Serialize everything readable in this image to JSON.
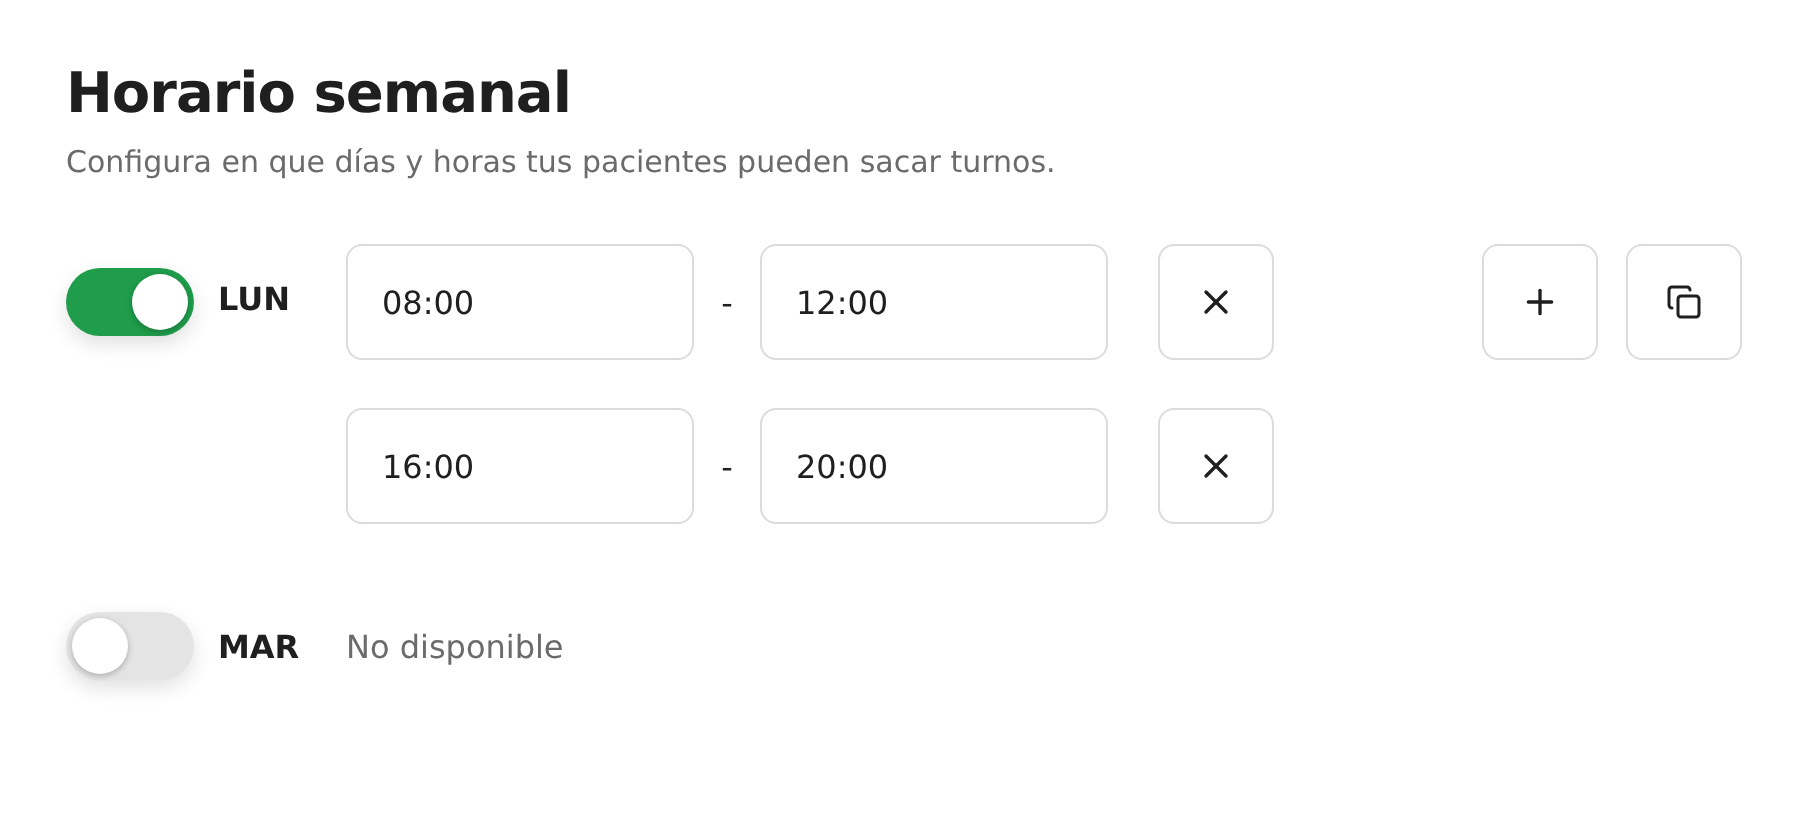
{
  "title": "Horario semanal",
  "subtitle": "Configura en que días y horas tus pacientes pueden sacar turnos.",
  "days": [
    {
      "label": "LUN",
      "on": true,
      "slots": [
        {
          "start": "08:00",
          "separator": "-",
          "end": "12:00"
        },
        {
          "start": "16:00",
          "separator": "-",
          "end": "20:00"
        }
      ]
    },
    {
      "label": "MAR",
      "on": false,
      "status": "No disponible"
    }
  ]
}
